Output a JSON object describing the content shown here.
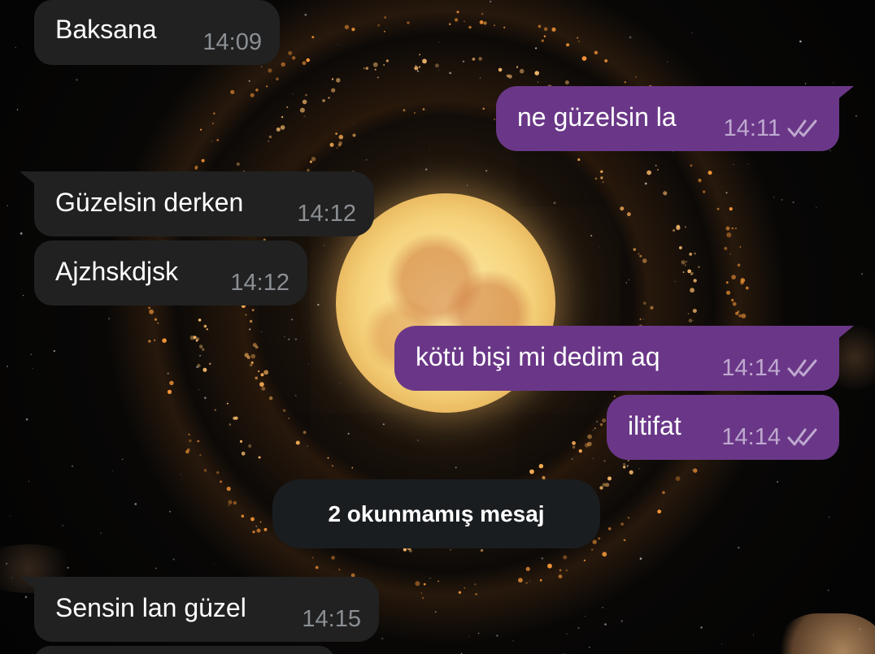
{
  "messages": [
    {
      "direction": "incoming",
      "text": "Baksana",
      "time": "14:09"
    },
    {
      "direction": "outgoing",
      "text": "ne güzelsin la",
      "time": "14:11",
      "read_icon": "double-check-icon"
    },
    {
      "direction": "incoming",
      "text": "Güzelsin derken",
      "time": "14:12"
    },
    {
      "direction": "incoming",
      "text": "Ajzhskdjsk",
      "time": "14:12"
    },
    {
      "direction": "outgoing",
      "text": "kötü bişi mi dedim aq",
      "time": "14:14",
      "read_icon": "double-check-icon"
    },
    {
      "direction": "outgoing",
      "text": "iltifat",
      "time": "14:14",
      "read_icon": "double-check-icon"
    },
    {
      "direction": "incoming",
      "text": "Sensin lan güzel",
      "time": "14:15"
    }
  ],
  "unread_divider": {
    "label": "2 okunmamış mesaj"
  },
  "colors": {
    "incoming_bubble": "#212121",
    "outgoing_bubble": "#6a3788",
    "incoming_time": "#8b8f93",
    "outgoing_time": "#bfa9cf",
    "unread_pill": "#1a1d20"
  },
  "wallpaper": {
    "subject": "full moon with glowing ring of lights"
  }
}
